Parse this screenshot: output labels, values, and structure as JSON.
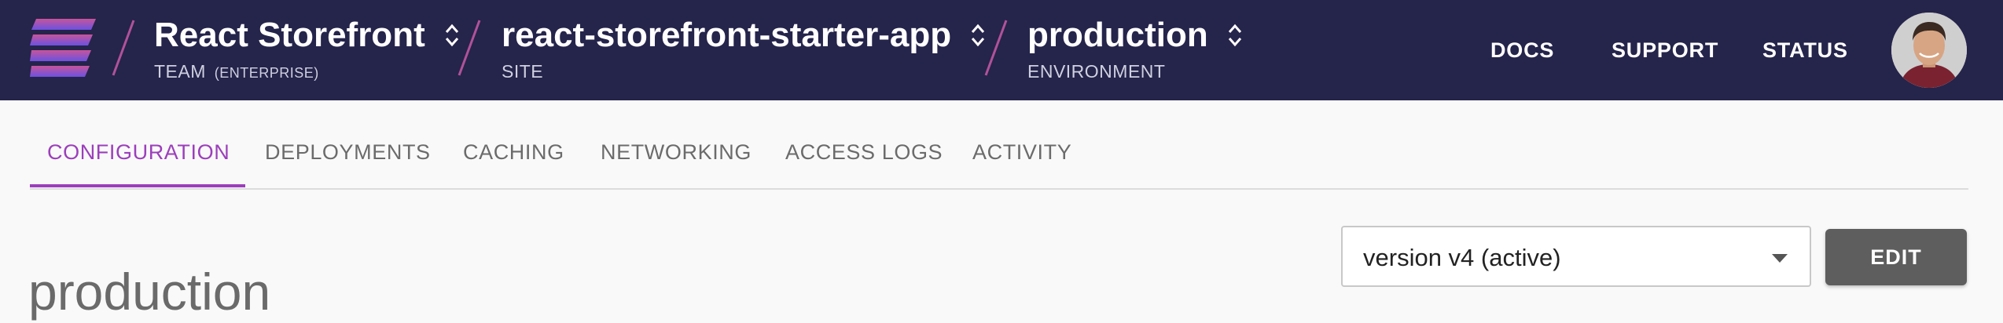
{
  "header": {
    "logo": "stacked-bars-logo",
    "team": {
      "name": "React Storefront",
      "label": "TEAM",
      "tier": "(ENTERPRISE)"
    },
    "site": {
      "name": "react-storefront-starter-app",
      "label": "SITE"
    },
    "environment": {
      "name": "production",
      "label": "ENVIRONMENT"
    },
    "links": [
      "DOCS",
      "SUPPORT",
      "STATUS"
    ],
    "colors": {
      "bar": "#25244b",
      "slash": "#b0529a"
    }
  },
  "tabs": [
    {
      "label": "CONFIGURATION",
      "active": true
    },
    {
      "label": "DEPLOYMENTS",
      "active": false
    },
    {
      "label": "CACHING",
      "active": false
    },
    {
      "label": "NETWORKING",
      "active": false
    },
    {
      "label": "ACCESS LOGS",
      "active": false
    },
    {
      "label": "ACTIVITY",
      "active": false
    }
  ],
  "main": {
    "title": "production",
    "version_select": {
      "value": "version v4 (active)"
    },
    "edit_label": "EDIT"
  },
  "colors": {
    "accent": "#9c3fbb",
    "button": "#5e5e5e"
  }
}
